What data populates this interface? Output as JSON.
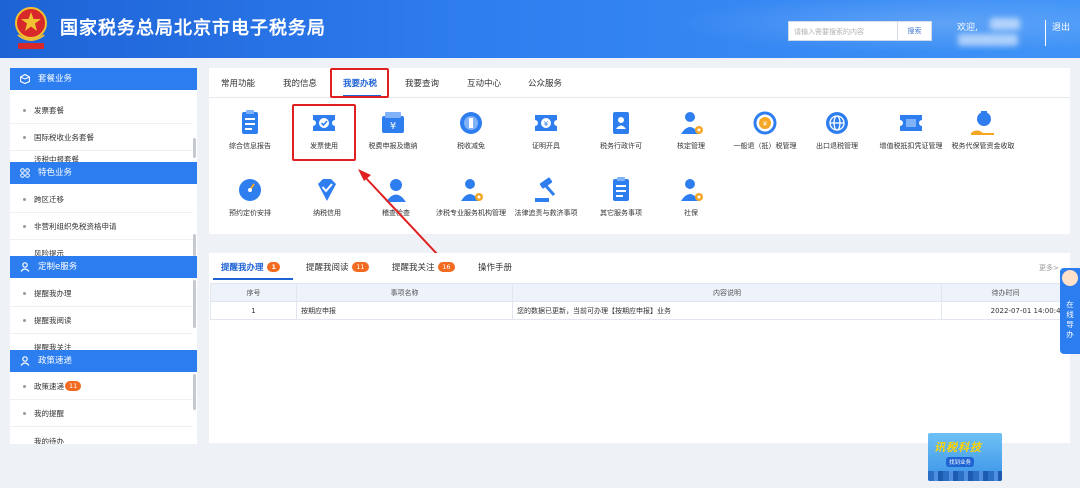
{
  "header": {
    "title": "国家税务总局北京市电子税务局",
    "search_placeholder": "请输入需要搜索的内容",
    "search_button": "搜索",
    "welcome": "欢迎,",
    "logout": "退出",
    "separator": "|"
  },
  "sidebar": {
    "sections": [
      {
        "title": "套餐业务",
        "items": [
          "发票套餐",
          "国际税收业务套餐",
          "涉税中报套餐"
        ]
      },
      {
        "title": "特色业务",
        "items": [
          "跨区迁移",
          "非营利组织免税资格申请",
          "风险提示"
        ]
      },
      {
        "title": "定制e服务",
        "items": [
          "提醒我办理",
          "提醒我阅读",
          "提醒我关注"
        ]
      },
      {
        "title": "政策速递",
        "items": [
          "政策速递",
          "我的提醒",
          "我的待办"
        ],
        "badge": "11"
      }
    ]
  },
  "main": {
    "tabs": [
      "常用功能",
      "我的信息",
      "我要办税",
      "我要查询",
      "互动中心",
      "公众服务"
    ],
    "active_tab": "我要办税",
    "services_row1": [
      "综合信息报告",
      "发票使用",
      "税费申报及缴纳",
      "税收减免",
      "证明开具",
      "税务行政许可",
      "核定管理",
      "一般退（抵）税管理",
      "出口退税管理",
      "增值税抵扣凭证管理",
      "税务代保管资金收取"
    ],
    "services_row2": [
      "预约定价安排",
      "纳税信用",
      "稽查检查",
      "涉税专业服务机构管理",
      "法律追责与救济事项",
      "其它服务事项",
      "社保"
    ],
    "highlighted_service": "发票使用"
  },
  "reminders": {
    "tabs": [
      {
        "label": "提醒我办理",
        "badge": "1"
      },
      {
        "label": "提醒我阅读",
        "badge": "11"
      },
      {
        "label": "提醒我关注",
        "badge": "16"
      },
      {
        "label": "操作手册",
        "badge": ""
      }
    ],
    "more": "更多>",
    "columns": [
      "序号",
      "事项名称",
      "内容说明",
      "待办时间"
    ],
    "rows": [
      [
        "1",
        "按期应申报",
        "您的数据已更新，当前可办理【按期应申报】业务",
        "2022-07-01 14:00:45"
      ]
    ]
  },
  "float_guide": {
    "label": "在线导办"
  },
  "promo": {
    "title": "讯税科技",
    "subtitle": "找到业务"
  },
  "colors": {
    "primary": "#2c7df0",
    "highlight": "#e02020",
    "badge": "#f26b21"
  }
}
